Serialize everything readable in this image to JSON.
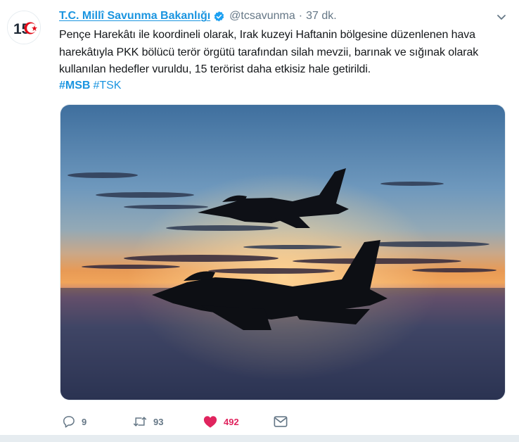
{
  "tweet": {
    "display_name": "T.C. Millî Savunma Bakanlığı",
    "handle": "@tcsavunma",
    "separator": "·",
    "time": "37 dk.",
    "text": "Pençe Harekâtı ile koordineli olarak, Irak kuzeyi Haftanin bölgesine düzenlenen hava harekâtıyla PKK bölücü terör örgütü tarafından silah mevzii, barınak ve sığınak olarak kullanılan hedefler vuruldu, 15 terörist daha etkisiz hale getirildi.",
    "hashtags": [
      "#MSB",
      "#TSK"
    ],
    "avatar": {
      "text": "15",
      "icon": "turkish-flag-crescent-star"
    }
  },
  "actions": {
    "reply": {
      "icon": "reply-icon",
      "count": "9"
    },
    "retweet": {
      "icon": "retweet-icon",
      "count": "93"
    },
    "like": {
      "icon": "heart-icon",
      "count": "492"
    },
    "dm": {
      "icon": "envelope-icon"
    }
  },
  "colors": {
    "link": "#1b95e0",
    "muted": "#657786",
    "like": "#e0245e",
    "verified": "#1da1f2"
  }
}
